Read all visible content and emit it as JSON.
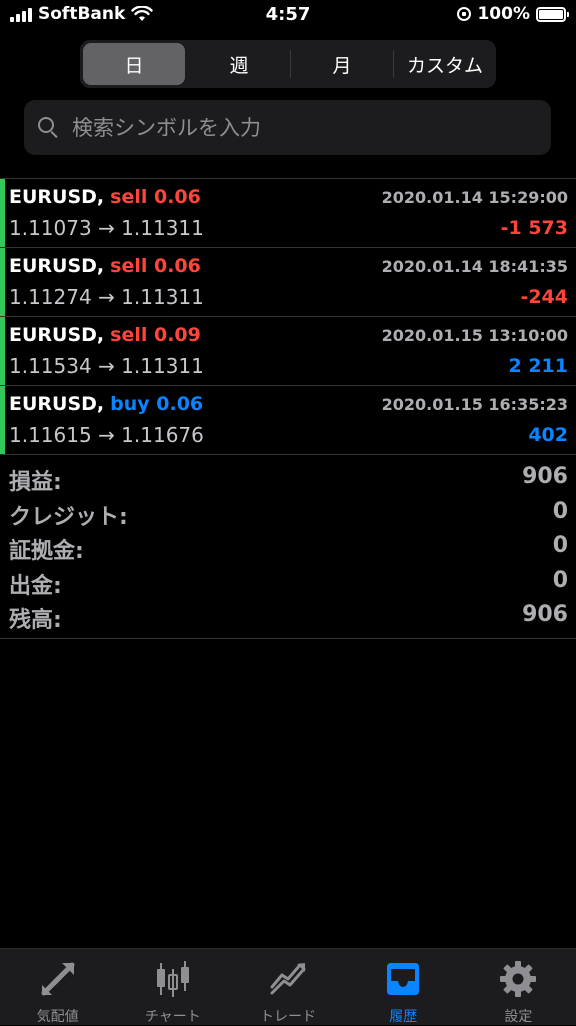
{
  "status_bar": {
    "carrier": "SoftBank",
    "time": "4:57",
    "battery": "100%"
  },
  "segments": [
    {
      "label": "日",
      "active": true
    },
    {
      "label": "週",
      "active": false
    },
    {
      "label": "月",
      "active": false
    },
    {
      "label": "カスタム",
      "active": false
    }
  ],
  "search": {
    "placeholder": "検索シンボルを入力"
  },
  "trades": [
    {
      "symbol": "EURUSD,",
      "type": "sell",
      "type_text": "sell 0.06",
      "time": "2020.01.14 15:29:00",
      "prices": "1.11073 → 1.11311",
      "profit": "-1 573"
    },
    {
      "symbol": "EURUSD,",
      "type": "sell",
      "type_text": "sell 0.06",
      "time": "2020.01.14 18:41:35",
      "prices": "1.11274 → 1.11311",
      "profit": "-244"
    },
    {
      "symbol": "EURUSD,",
      "type": "sell",
      "type_text": "sell 0.09",
      "time": "2020.01.15 13:10:00",
      "prices": "1.11534 → 1.11311",
      "profit": "2 211"
    },
    {
      "symbol": "EURUSD,",
      "type": "buy",
      "type_text": "buy 0.06",
      "time": "2020.01.15 16:35:23",
      "prices": "1.11615 → 1.11676",
      "profit": "402"
    }
  ],
  "summary": [
    {
      "label": "損益:",
      "value": "906"
    },
    {
      "label": "クレジット:",
      "value": "0"
    },
    {
      "label": "証拠金:",
      "value": "0"
    },
    {
      "label": "出金:",
      "value": "0"
    },
    {
      "label": "残高:",
      "value": "906"
    }
  ],
  "tabs": [
    {
      "label": "気配値",
      "icon": "quotes-icon"
    },
    {
      "label": "チャート",
      "icon": "candlestick-chart-icon"
    },
    {
      "label": "トレード",
      "icon": "trade-icon"
    },
    {
      "label": "履歴",
      "icon": "history-inbox-icon",
      "active": true
    },
    {
      "label": "設定",
      "icon": "gear-icon"
    }
  ],
  "colors": {
    "sell": "#ff453a",
    "buy": "#0a84ff",
    "trade_bar": "#34c759",
    "active_tab": "#0a84ff"
  }
}
